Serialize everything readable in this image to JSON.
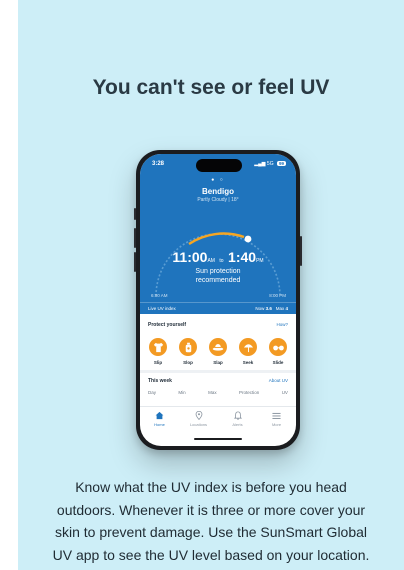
{
  "headline": "You can't see or feel UV",
  "phone": {
    "status": {
      "time": "3:28",
      "signal": "5G",
      "battery": "99"
    },
    "location": {
      "city": "Bendigo",
      "condition": "Partly Cloudy | 18°"
    },
    "protection_window": {
      "start_time": "11:00",
      "start_suffix": "AM",
      "to": "to",
      "end_time": "1:40",
      "end_suffix": "PM",
      "message_line1": "Sun protection",
      "message_line2": "recommended",
      "arc_start_label": "6:00 AM",
      "arc_end_label": "8:00 PM"
    },
    "live_uv": {
      "label": "Live UV index",
      "now_label": "Now",
      "now_value": "3.6",
      "max_label": "Max",
      "max_value": "4"
    },
    "protect": {
      "title": "Protect yourself",
      "link": "How?",
      "items": [
        {
          "label": "Slip",
          "icon": "shirt-icon"
        },
        {
          "label": "Slop",
          "icon": "sunscreen-icon"
        },
        {
          "label": "Slap",
          "icon": "hat-icon"
        },
        {
          "label": "Seek",
          "icon": "umbrella-icon"
        },
        {
          "label": "Slide",
          "icon": "sunglasses-icon"
        }
      ]
    },
    "week": {
      "title": "This week",
      "link": "About UV",
      "columns": [
        "Day",
        "Min",
        "Max",
        "Protection",
        "UV"
      ]
    },
    "tabs": [
      {
        "label": "Home",
        "icon": "home-icon",
        "active": true
      },
      {
        "label": "Locations",
        "icon": "location-pin-icon",
        "active": false
      },
      {
        "label": "Alerts",
        "icon": "bell-icon",
        "active": false
      },
      {
        "label": "More",
        "icon": "menu-icon",
        "active": false
      }
    ]
  },
  "body_lines": [
    "Know what the UV index is before you head",
    "outdoors. Whenever it is three or more cover your",
    "skin to prevent damage. Use the SunSmart Global",
    "UV app to see the UV level based on your location."
  ],
  "colors": {
    "background": "#cdeef7",
    "app_blue": "#1f74bd",
    "protect_orange": "#f39a23",
    "arc_orange": "#f5a623"
  }
}
